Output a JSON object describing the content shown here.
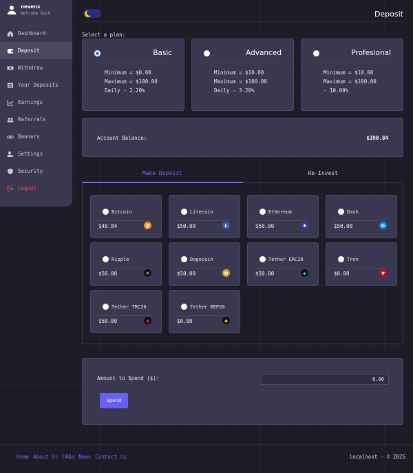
{
  "user": {
    "name": "nevenx",
    "subtitle": "Welcome Back"
  },
  "sidebar": {
    "items": [
      {
        "label": "Dashboard",
        "icon": "home-icon"
      },
      {
        "label": "Deposit",
        "icon": "wallet-icon",
        "active": true
      },
      {
        "label": "Withdraw",
        "icon": "money-icon"
      },
      {
        "label": "Your Deposits",
        "icon": "list-icon"
      },
      {
        "label": "Earnings",
        "icon": "chart-icon"
      },
      {
        "label": "Referrals",
        "icon": "users-icon"
      },
      {
        "label": "Banners",
        "icon": "link-icon"
      },
      {
        "label": "Settings",
        "icon": "user-gear-icon"
      },
      {
        "label": "Security",
        "icon": "shield-icon"
      },
      {
        "label": "Logout",
        "icon": "logout-icon"
      }
    ]
  },
  "header": {
    "title": "Deposit"
  },
  "plans_section": {
    "label": "Select a plan:"
  },
  "plans": [
    {
      "name": "Basic",
      "min": "Minimum = $0.00",
      "max": "Maximum = $100.00",
      "rate": "Daily - 2.20%",
      "selected": true
    },
    {
      "name": "Advanced",
      "min": "Minimum = $10.00",
      "max": "Maximum = $100.00",
      "rate": "Daily - 3.20%",
      "selected": false
    },
    {
      "name": "Profesional",
      "min": "Minimum = $10.00",
      "max": "Maximum = $100.00",
      "rate": "- 10.00%",
      "selected": false
    }
  ],
  "balance": {
    "label": "Account Balance:",
    "value": "$390.84"
  },
  "tabs": [
    {
      "label": "Make Deposit",
      "active": true
    },
    {
      "label": "Re-Invest",
      "active": false
    }
  ],
  "gateways": [
    {
      "name": "Bitcoin",
      "amount": "$40.84",
      "icon": "bitcoin-icon",
      "color": "#f7931a",
      "glyph": "₿"
    },
    {
      "name": "Litecoin",
      "amount": "$50.00",
      "icon": "litecoin-icon",
      "color": "#345d9d",
      "glyph": "Ł"
    },
    {
      "name": "Ethereum",
      "amount": "$50.00",
      "icon": "ethereum-icon",
      "color": "#3c3c9d",
      "glyph": "♦"
    },
    {
      "name": "Dash",
      "amount": "$50.00",
      "icon": "dash-icon",
      "color": "#008de4",
      "glyph": "D"
    },
    {
      "name": "Ripple",
      "amount": "$50.00",
      "icon": "ripple-icon",
      "color": "#111111",
      "glyph": "✕"
    },
    {
      "name": "Dogecoin",
      "amount": "$50.00",
      "icon": "dogecoin-icon",
      "color": "#c2a633",
      "glyph": "Ð"
    },
    {
      "name": "Tether ERC20",
      "amount": "$50.00",
      "icon": "tether-erc20-icon",
      "color": "#111111",
      "glyph": "◆"
    },
    {
      "name": "Tron",
      "amount": "$0.00",
      "icon": "tron-icon",
      "color": "#c4091f",
      "glyph": "▼"
    },
    {
      "name": "Tether TRC20",
      "amount": "$50.00",
      "icon": "tether-trc20-icon",
      "color": "#111111",
      "glyph": "◆"
    },
    {
      "name": "Tether BEP20",
      "amount": "$0.00",
      "icon": "tether-bep20-icon",
      "color": "#111111",
      "glyph": "◆"
    }
  ],
  "amount": {
    "label": "Amount to Spend ($):",
    "value": "0.00",
    "button": "Spend"
  },
  "footer": {
    "links": [
      "Home",
      "About Us",
      "FAQs",
      "News",
      "Contact Us"
    ],
    "copyright": "localhost - © 2025"
  },
  "colors": {
    "accent": "#6e6af5",
    "panel": "#3a3850",
    "background": "#1c1b26",
    "logout": "#f0505a"
  }
}
